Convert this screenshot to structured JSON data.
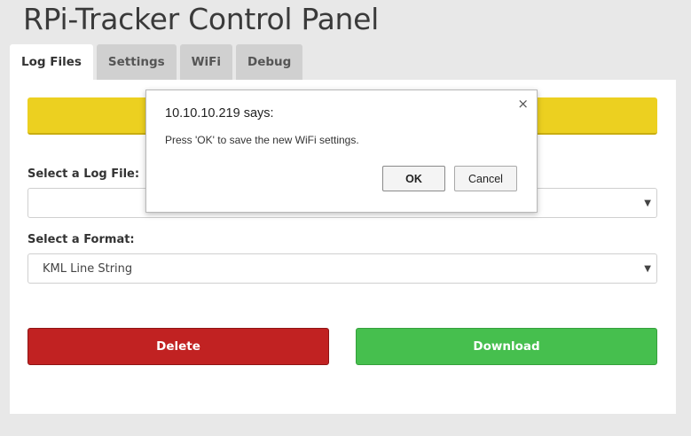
{
  "header": {
    "title": "RPi-Tracker Control Panel"
  },
  "tabs": [
    {
      "label": "Log Files",
      "active": true
    },
    {
      "label": "Settings",
      "active": false
    },
    {
      "label": "WiFi",
      "active": false
    },
    {
      "label": "Debug",
      "active": false
    }
  ],
  "log_files": {
    "status_bar_color": "#ecd020",
    "select_log_label": "Select a Log File:",
    "select_log_value": "",
    "select_format_label": "Select a Format:",
    "select_format_value": "KML Line String",
    "delete_label": "Delete",
    "download_label": "Download",
    "delete_color": "#c12222",
    "download_color": "#46bf4e"
  },
  "dialog": {
    "title": "10.10.10.219 says:",
    "message": "Press 'OK' to save the new WiFi settings.",
    "ok_label": "OK",
    "cancel_label": "Cancel",
    "close_glyph": "×"
  }
}
